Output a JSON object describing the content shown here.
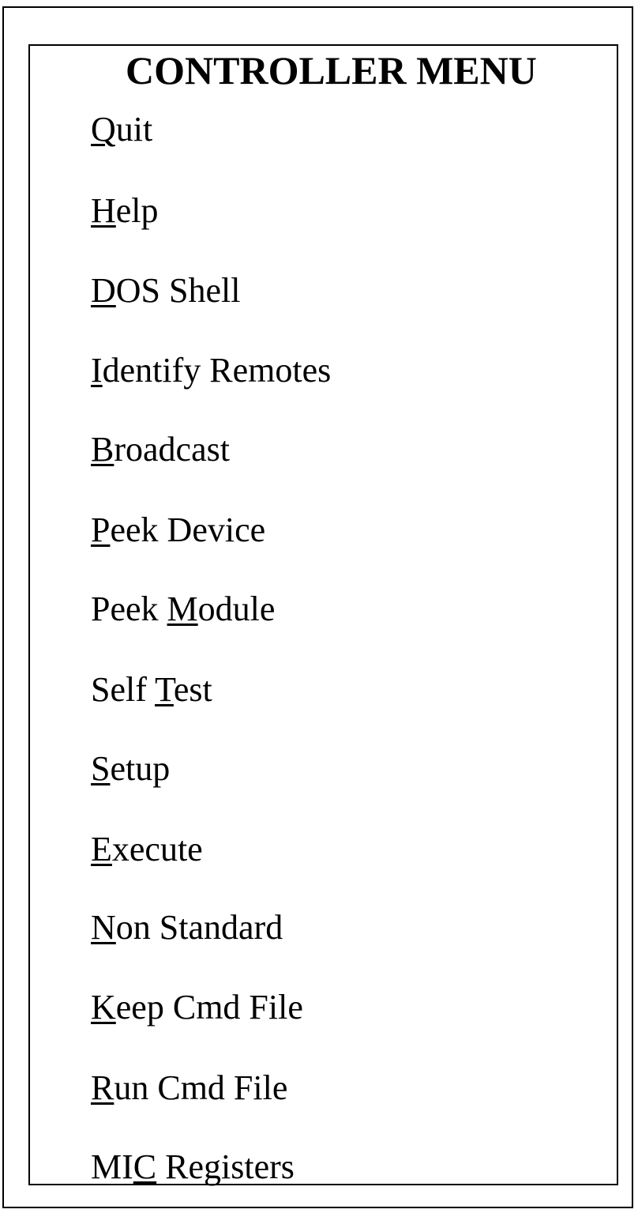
{
  "menu": {
    "title": "CONTROLLER MENU",
    "items": [
      {
        "before": "",
        "hotkey": "Q",
        "after": "uit"
      },
      {
        "before": "",
        "hotkey": "H",
        "after": "elp"
      },
      {
        "before": "",
        "hotkey": "D",
        "after": "OS Shell"
      },
      {
        "before": "",
        "hotkey": "I",
        "after": "dentify Remotes"
      },
      {
        "before": "",
        "hotkey": "B",
        "after": "roadcast"
      },
      {
        "before": "",
        "hotkey": "P",
        "after": "eek Device"
      },
      {
        "before": "Peek ",
        "hotkey": "M",
        "after": "odule"
      },
      {
        "before": "Self ",
        "hotkey": "T",
        "after": "est"
      },
      {
        "before": "",
        "hotkey": "S",
        "after": "etup"
      },
      {
        "before": "",
        "hotkey": "E",
        "after": "xecute"
      },
      {
        "before": "",
        "hotkey": "N",
        "after": "on Standard"
      },
      {
        "before": "",
        "hotkey": "K",
        "after": "eep Cmd File"
      },
      {
        "before": "",
        "hotkey": "R",
        "after": "un Cmd File"
      },
      {
        "before": "MI",
        "hotkey": "C",
        "after": " Registers"
      }
    ]
  }
}
